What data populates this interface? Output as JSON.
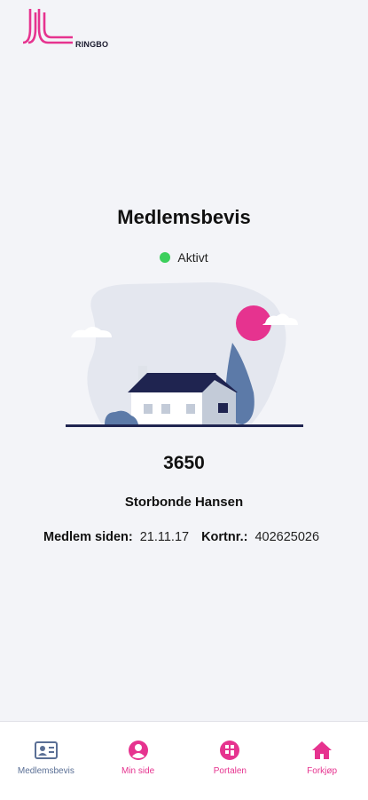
{
  "header": {
    "logo_text": "RINGBO"
  },
  "card": {
    "title": "Medlemsbevis",
    "status": "Aktivt",
    "member_number": "3650",
    "member_name": "Storbonde Hansen",
    "member_since_label": "Medlem siden:",
    "member_since_value": "21.11.17",
    "card_no_label": "Kortnr.:",
    "card_no_value": "402625026"
  },
  "nav": {
    "items": [
      {
        "label": "Medlemsbevis",
        "icon": "id-card-icon",
        "active": true
      },
      {
        "label": "Min side",
        "icon": "user-icon",
        "active": false
      },
      {
        "label": "Portalen",
        "icon": "portal-icon",
        "active": false
      },
      {
        "label": "Forkjøp",
        "icon": "home-icon",
        "active": false
      }
    ]
  },
  "colors": {
    "accent": "#e6338f",
    "status_active": "#3ccf5c",
    "nav_active": "#5a6f95",
    "background": "#f3f4f8"
  }
}
